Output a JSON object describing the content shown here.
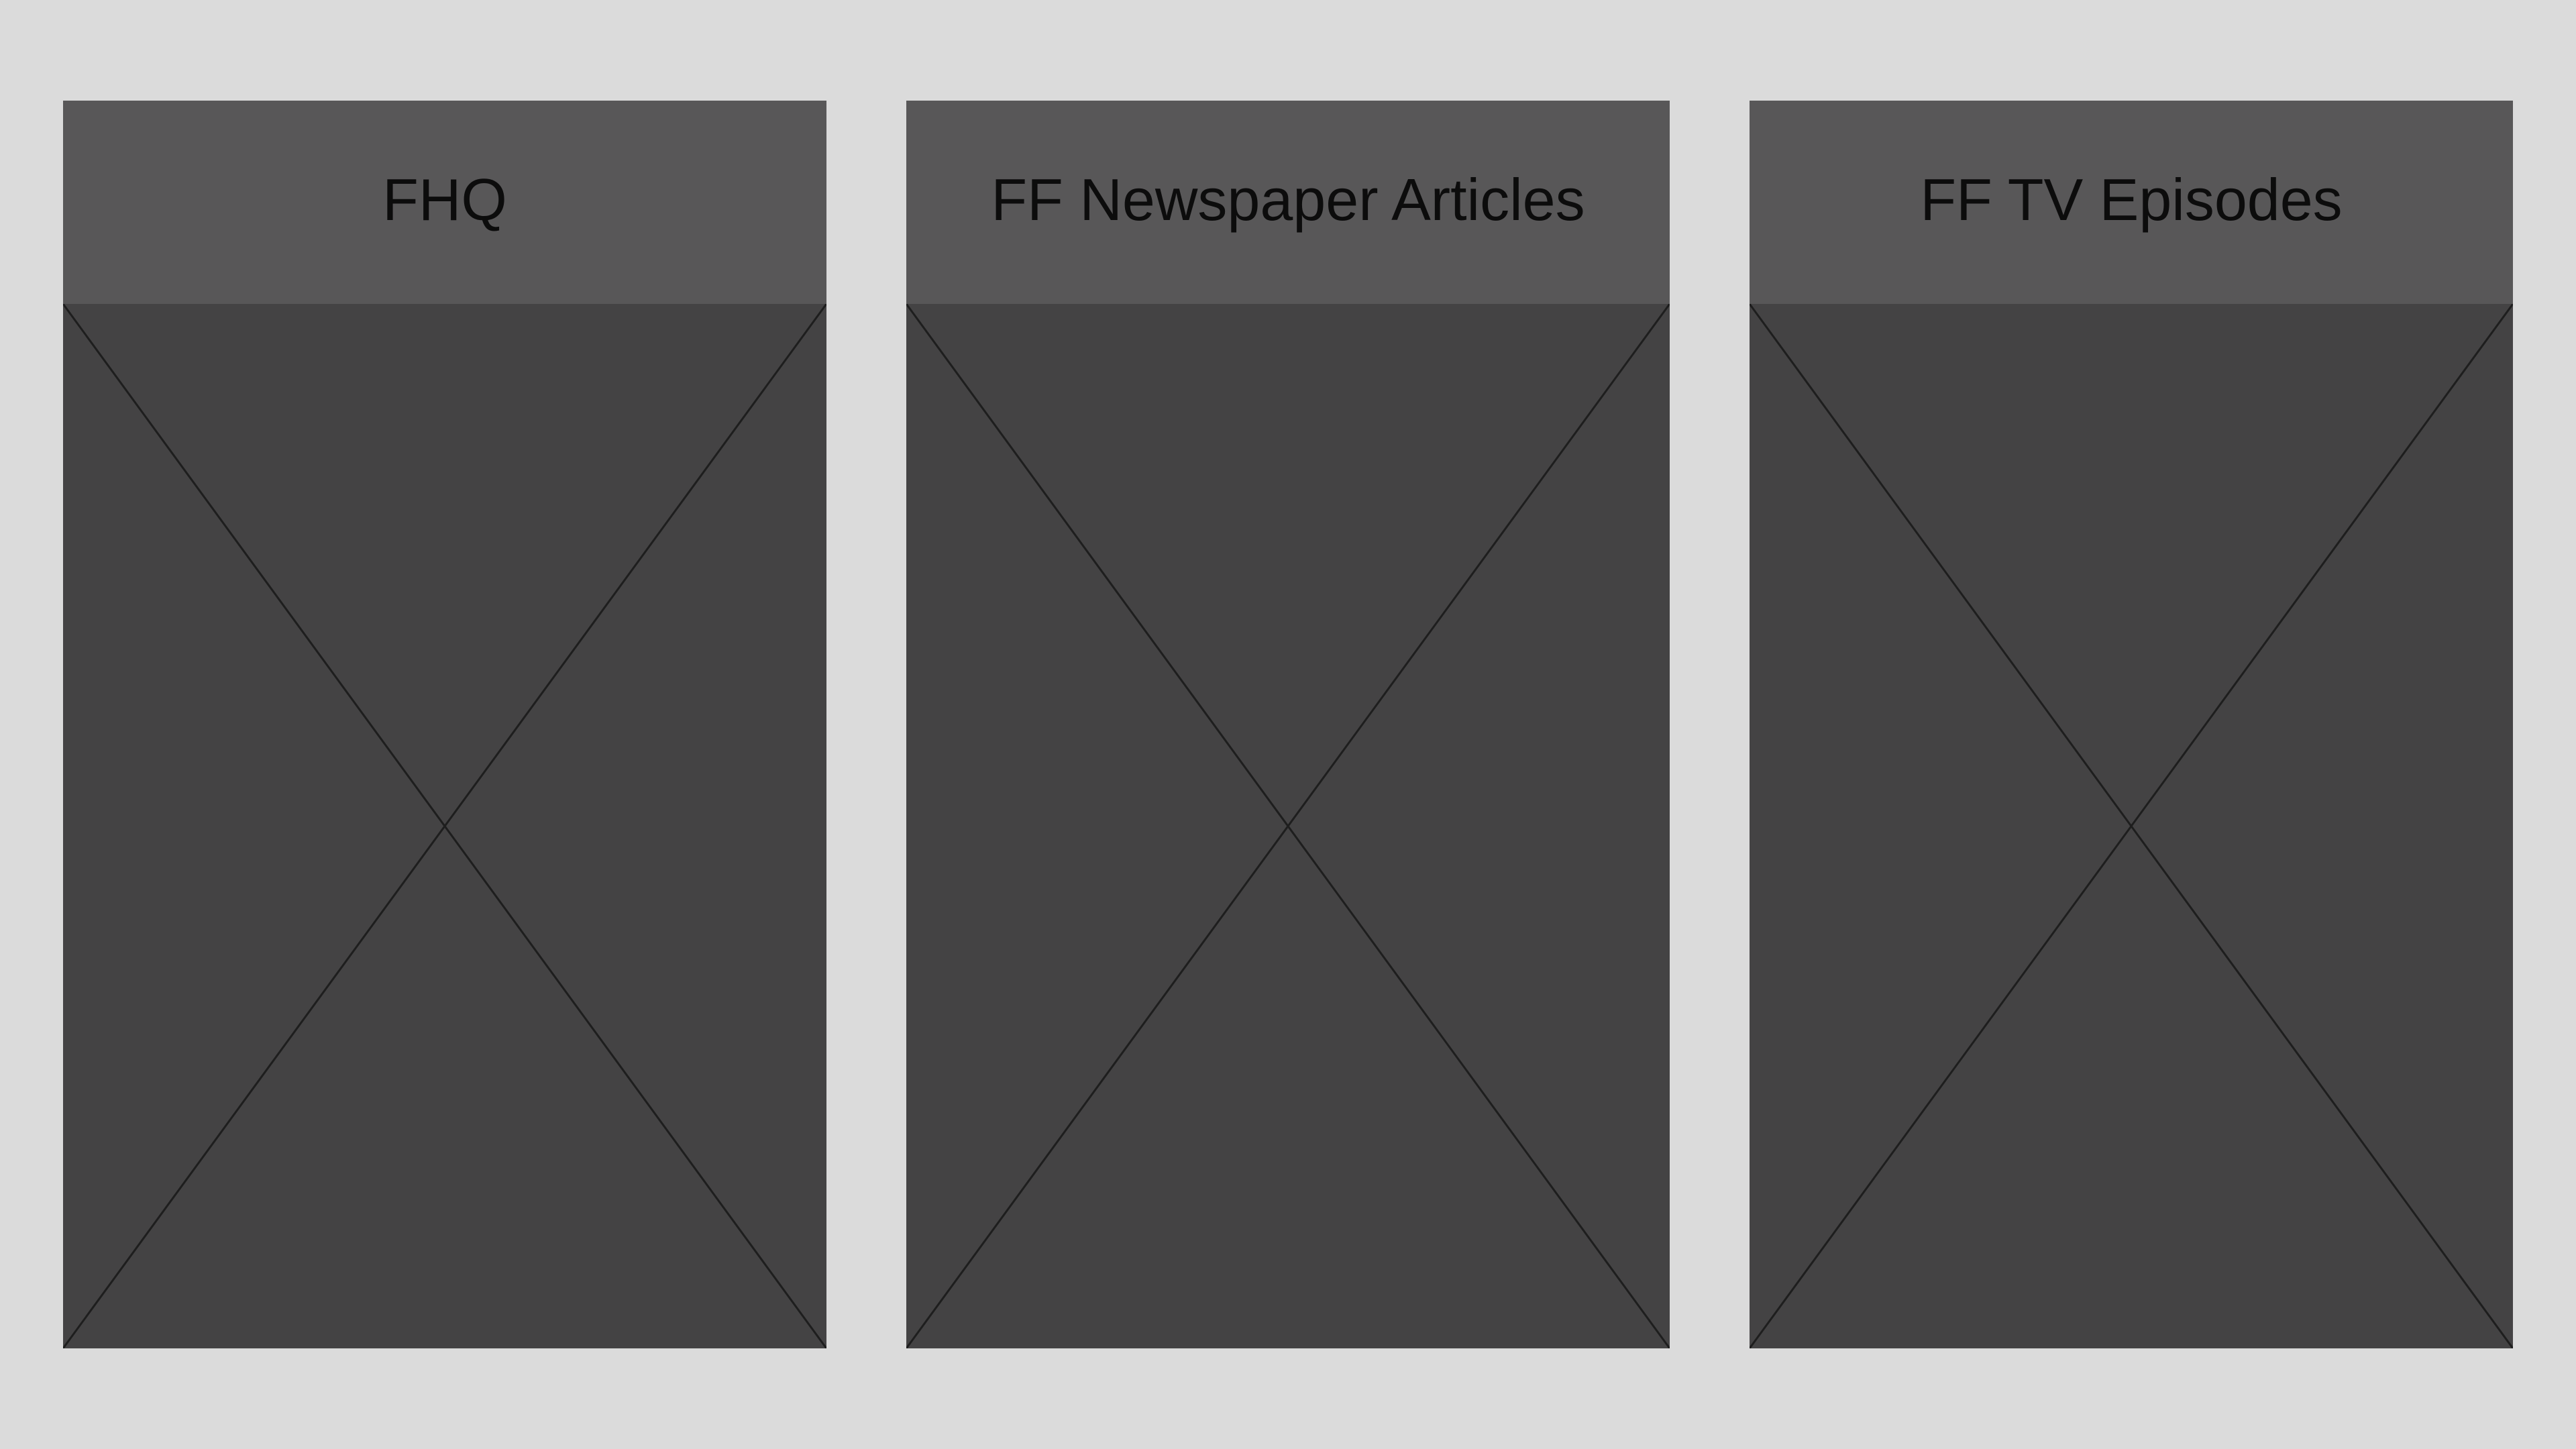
{
  "cards": [
    {
      "title": "FHQ",
      "image_icon": "image-placeholder-icon"
    },
    {
      "title": "FF Newspaper Articles",
      "image_icon": "image-placeholder-icon"
    },
    {
      "title": "FF TV Episodes",
      "image_icon": "image-placeholder-icon"
    }
  ],
  "colors": {
    "background": "#dbdbdb",
    "header": "#585758",
    "image_area": "#444344",
    "text": "#0c0c0c",
    "placeholder_lines": "#1e1e1e"
  }
}
